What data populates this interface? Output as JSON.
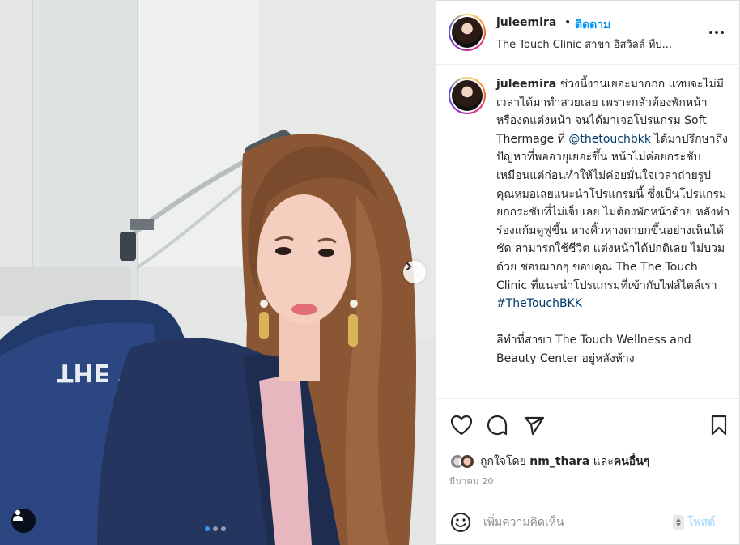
{
  "post": {
    "username": "juleemira",
    "separator": "•",
    "follow_label": "ติดตาม",
    "location": "The Touch Clinic สาขา อิสวิลล์ ทีป...",
    "caption": {
      "username": "juleemira",
      "text_1": " ช่วงนี้งานเยอะมากกก แทบจะไม่มีเวลาได้มาทำสวยเลย เพราะกลัวต้องพักหน้า หรืองดแต่งหน้า จนได้มาเจอโปรแกรม Soft Thermage ที่ ",
      "mention": "@thetouchbkk",
      "text_2": " ได้มาปรึกษาถึงปัญหาที่พออายุเยอะขึ้น หน้าไม่ค่อยกระชับเหมือนแต่ก่อนทำให้ไม่ค่อยมั่นใจเวลาถ่ายรูป คุณหมอเลยแนะนำโปรแกรมนี้ ซึ่งเป็นโปรแกรมยกกระชับที่ไม่เจ็บเลย ไม่ต้องพักหน้าด้วย หลังทำร่องแก้มดูฟูขึ้น หางคิ้วหางตายกขึ้นอย่างเห็นได้ชัด สามารถใช้ชีวิต แต่งหน้าได้ปกติเลย ไม่บวมด้วย ชอบมากๆ ขอบคุณ The The Touch Clinic ที่แนะนำโปรแกรมที่เข้ากับไฟส์ไตล์เรา ",
      "hashtag": "#TheTouchBKK",
      "text_3": "\n\nลีทำที่สาขา The Touch Wellness and Beauty Center อยู่หลังห้าง"
    },
    "liked_by_prefix": "ถูกใจโดย",
    "liked_by_user": "nm_thara",
    "liked_by_suffix": "และ",
    "liked_by_others": "คนอื่นๆ",
    "date": "มีนาคม 20",
    "comment_placeholder": "เพิ่มความคิดเห็น",
    "post_button_label": "โพสต์"
  },
  "icons": {
    "more": "more-horizontal-icon",
    "like": "heart-icon",
    "comment": "comment-icon",
    "share": "paper-plane-icon",
    "save": "bookmark-icon",
    "emoji": "emoji-icon",
    "next": "chevron-right-icon",
    "user_tag": "user-tag-icon"
  },
  "carousel": {
    "slide_count": 3,
    "active_index": 0
  },
  "colors": {
    "link": "#0095f6",
    "mention": "#00376b",
    "post_disabled": "#b2dffc",
    "carousel_active": "#3897f0"
  }
}
